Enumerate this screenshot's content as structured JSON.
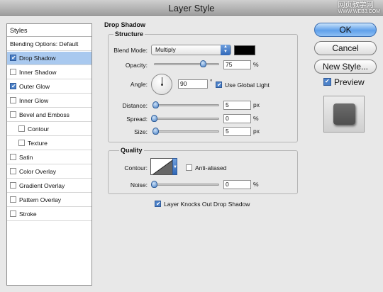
{
  "window": {
    "title": "Layer Style"
  },
  "watermark": {
    "text": "网页教学网",
    "url": "WWW.WEB3.COM"
  },
  "styles_panel": {
    "header": "Styles",
    "items": [
      {
        "label": "Blending Options: Default",
        "has_checkbox": false,
        "checked": false,
        "active": false,
        "sub": false
      },
      {
        "label": "Drop Shadow",
        "has_checkbox": true,
        "checked": true,
        "active": true,
        "sub": false
      },
      {
        "label": "Inner Shadow",
        "has_checkbox": true,
        "checked": false,
        "active": false,
        "sub": false
      },
      {
        "label": "Outer Glow",
        "has_checkbox": true,
        "checked": true,
        "active": false,
        "sub": false
      },
      {
        "label": "Inner Glow",
        "has_checkbox": true,
        "checked": false,
        "active": false,
        "sub": false
      },
      {
        "label": "Bevel and Emboss",
        "has_checkbox": true,
        "checked": false,
        "active": false,
        "sub": false
      },
      {
        "label": "Contour",
        "has_checkbox": true,
        "checked": false,
        "active": false,
        "sub": true
      },
      {
        "label": "Texture",
        "has_checkbox": true,
        "checked": false,
        "active": false,
        "sub": true
      },
      {
        "label": "Satin",
        "has_checkbox": true,
        "checked": false,
        "active": false,
        "sub": false
      },
      {
        "label": "Color Overlay",
        "has_checkbox": true,
        "checked": false,
        "active": false,
        "sub": false
      },
      {
        "label": "Gradient Overlay",
        "has_checkbox": true,
        "checked": false,
        "active": false,
        "sub": false
      },
      {
        "label": "Pattern Overlay",
        "has_checkbox": true,
        "checked": false,
        "active": false,
        "sub": false
      },
      {
        "label": "Stroke",
        "has_checkbox": true,
        "checked": false,
        "active": false,
        "sub": false
      }
    ]
  },
  "drop_shadow": {
    "title": "Drop Shadow",
    "structure": {
      "title": "Structure",
      "blend_mode_label": "Blend Mode:",
      "blend_mode_value": "Multiply",
      "shadow_color": "#000000",
      "opacity_label": "Opacity:",
      "opacity_value": "75",
      "opacity_unit": "%",
      "opacity_level": 0.75,
      "angle_label": "Angle:",
      "angle_value": "90",
      "angle_unit": "°",
      "angle_degrees": 90,
      "use_global_light_label": "Use Global Light",
      "use_global_light_checked": true,
      "distance_label": "Distance:",
      "distance_value": "5",
      "distance_unit": "px",
      "distance_level": 0.02,
      "spread_label": "Spread:",
      "spread_value": "0",
      "spread_unit": "%",
      "spread_level": 0.0,
      "size_label": "Size:",
      "size_value": "5",
      "size_unit": "px",
      "size_level": 0.02
    },
    "quality": {
      "title": "Quality",
      "contour_label": "Contour:",
      "anti_aliased_label": "Anti-aliased",
      "anti_aliased_checked": false,
      "noise_label": "Noise:",
      "noise_value": "0",
      "noise_unit": "%",
      "noise_level": 0.0
    },
    "knockout_label": "Layer Knocks Out Drop Shadow",
    "knockout_checked": true
  },
  "buttons": {
    "ok": "OK",
    "cancel": "Cancel",
    "new_style": "New Style..."
  },
  "preview": {
    "label": "Preview",
    "checked": true
  }
}
